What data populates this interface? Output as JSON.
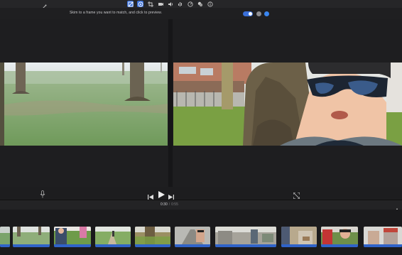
{
  "hint": {
    "text": "Skim to a frame you want to match, and click to preview."
  },
  "timeline": {
    "current": "0:30",
    "separator": "/",
    "total": "0:55"
  },
  "colors": {
    "accent": "#3a6fd8",
    "clip_bar": "#2f63c9"
  },
  "toolbar": {
    "tools": [
      "magic-wand-icon",
      "color-balance-icon",
      "color-correction-icon",
      "crop-icon",
      "stabilize-icon",
      "volume-icon",
      "noise-reduction-icon",
      "speed-icon",
      "filter-icon",
      "info-icon"
    ]
  }
}
